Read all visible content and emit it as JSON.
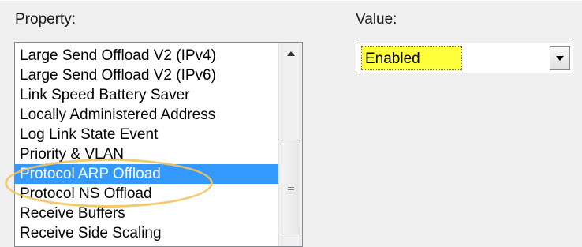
{
  "property": {
    "label": "Property:",
    "items": [
      {
        "label": "Large Send Offload V2 (IPv4)",
        "selected": false
      },
      {
        "label": "Large Send Offload V2 (IPv6)",
        "selected": false
      },
      {
        "label": "Link Speed Battery Saver",
        "selected": false
      },
      {
        "label": "Locally Administered Address",
        "selected": false
      },
      {
        "label": "Log Link State Event",
        "selected": false
      },
      {
        "label": "Priority & VLAN",
        "selected": false
      },
      {
        "label": "Protocol ARP Offload",
        "selected": true
      },
      {
        "label": "Protocol NS Offload",
        "selected": false
      },
      {
        "label": "Receive Buffers",
        "selected": false
      },
      {
        "label": "Receive Side Scaling",
        "selected": false
      }
    ]
  },
  "value": {
    "label": "Value:",
    "selected": "Enabled"
  },
  "colors": {
    "selection": "#3399ff",
    "highlight": "#ffff3c",
    "annotation_ring": "#f2c45c"
  },
  "icons": {
    "scroll_up": "triangle-up",
    "dropdown": "triangle-down",
    "scroll_grip": "grip-lines"
  }
}
